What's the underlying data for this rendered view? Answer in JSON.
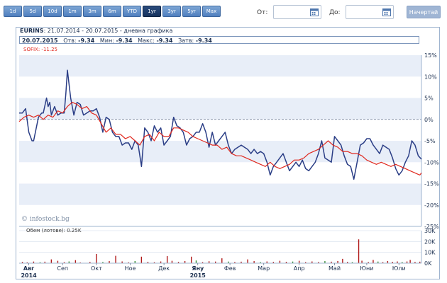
{
  "ranges": [
    "1d",
    "5d",
    "10d",
    "1m",
    "3m",
    "6m",
    "YTD",
    "1yr",
    "3yr",
    "5yr",
    "Max"
  ],
  "range_labels": [
    "1d",
    "5d",
    "10d",
    "1m",
    "3m",
    "6m",
    "YTD",
    "1yr",
    "3yr",
    "5yr",
    "Max"
  ],
  "active_range": "1yr",
  "date_from_label": "От:",
  "date_to_label": "До:",
  "submit_label": "Начертай",
  "chart_title_symbol": "EURINS",
  "chart_title_range": ": 21.07.2014 - 20.07.2015 - дневна графика",
  "info": {
    "date": "20.07.2015",
    "open_label": "Отв:",
    "open": "-9.34",
    "min_label": "Мин:",
    "min": "-9.34",
    "max_label": "Макс:",
    "max": "-9.34",
    "close_label": "Затв:",
    "close": "-9.34"
  },
  "sofix_label": "SOFIX: -11.25",
  "copyright": "© infostock.bg",
  "volume_label": "Обем (лотове): 0.25K",
  "colors": {
    "main_line": "#2b3e86",
    "sofix_line": "#e0291f",
    "band": "#e8eef8",
    "grid": "#c9d5e6"
  },
  "chart_data": {
    "type": "line",
    "x_tick_labels": [
      "Авг",
      "Сеп",
      "Окт",
      "Ное",
      "Дек",
      "Яну",
      "Фев",
      "Мар",
      "Апр",
      "Май",
      "Юни",
      "Юли"
    ],
    "year_labels": [
      "2014",
      "2015"
    ],
    "y_tick_labels": [
      "15%",
      "10%",
      "5%",
      "0%",
      "-5%",
      "-10%",
      "-15%",
      "-20%",
      "-25%"
    ],
    "ylim": [
      -25,
      15
    ],
    "volume_tick_labels": [
      "30K",
      "20K",
      "10K",
      "0K"
    ],
    "volume_ylim": [
      0,
      30
    ],
    "series": [
      {
        "name": "EURINS",
        "x": [
          0,
          2,
          4,
          6,
          8,
          9,
          12,
          14,
          15,
          17,
          18,
          19,
          20,
          22,
          24,
          26,
          28,
          29,
          30,
          32,
          34,
          36,
          38,
          40,
          42,
          44,
          46,
          48,
          50,
          52,
          54,
          56,
          58,
          60,
          62,
          64,
          66,
          68,
          70,
          72,
          74,
          76,
          78,
          80,
          82,
          84,
          86,
          88,
          90,
          92,
          94,
          96,
          98,
          100,
          102,
          104,
          106,
          108,
          110,
          112,
          114,
          116,
          118,
          120,
          122,
          124,
          126,
          128,
          130,
          132,
          134,
          136,
          138,
          140,
          142,
          144,
          146,
          148,
          150,
          152,
          154,
          156,
          158,
          160,
          162,
          164,
          166,
          168,
          170,
          172,
          174,
          176,
          178,
          180,
          182,
          184,
          186,
          188,
          190,
          192,
          194,
          196,
          198,
          200,
          202,
          204,
          206,
          208,
          210,
          212,
          214,
          216,
          218,
          220,
          222,
          224,
          226,
          228,
          230,
          232,
          234,
          236,
          238,
          240,
          242,
          244,
          246,
          248,
          250
        ],
        "values": [
          1.5,
          1.5,
          2.5,
          -3,
          -5,
          -5,
          0.5,
          1.5,
          1.5,
          5,
          3,
          4,
          1,
          3,
          1,
          1.5,
          1.5,
          6,
          11.5,
          5,
          1,
          4,
          3.5,
          1,
          1.5,
          2,
          2,
          2.5,
          0.5,
          -3,
          0.5,
          0,
          -3,
          -4,
          -4,
          -6,
          -5.5,
          -5.5,
          -7,
          -5,
          -6,
          -11,
          -2,
          -3,
          -5,
          -1.5,
          -3,
          -2,
          -6,
          -5,
          -4,
          0.5,
          -1.5,
          -2,
          -3,
          -6,
          -4.5,
          -4,
          -3,
          -3,
          -1,
          -3,
          -6.5,
          -3,
          -6,
          -5,
          -4,
          -3,
          -6,
          -8,
          -7,
          -6.5,
          -6,
          -6.5,
          -7,
          -8,
          -7,
          -8,
          -7.5,
          -8,
          -10,
          -13,
          -11,
          -10,
          -9,
          -8,
          -10,
          -12,
          -11,
          -10,
          -11,
          -9.5,
          -11.5,
          -12,
          -11,
          -10,
          -8,
          -5,
          -9,
          -9.5,
          -10,
          -4,
          -5,
          -6,
          -8.5,
          -10.5,
          -11,
          -14,
          -10,
          -6,
          -5.5,
          -4.5,
          -4.5,
          -6,
          -7,
          -8,
          -6,
          -6.5,
          -7,
          -9,
          -11.5,
          -13,
          -12,
          -10,
          -8.5,
          -5,
          -6,
          -8.5,
          -9.3
        ]
      },
      {
        "name": "SOFIX",
        "x": [
          0,
          3,
          6,
          9,
          12,
          15,
          18,
          21,
          24,
          27,
          30,
          33,
          36,
          39,
          42,
          45,
          48,
          51,
          54,
          57,
          60,
          63,
          66,
          69,
          72,
          75,
          78,
          81,
          84,
          87,
          90,
          93,
          96,
          99,
          102,
          105,
          108,
          111,
          114,
          117,
          120,
          123,
          126,
          129,
          132,
          135,
          138,
          141,
          144,
          147,
          150,
          153,
          156,
          159,
          162,
          165,
          168,
          171,
          174,
          177,
          180,
          183,
          186,
          189,
          192,
          195,
          198,
          201,
          204,
          207,
          210,
          213,
          216,
          219,
          222,
          225,
          228,
          231,
          234,
          237,
          240,
          243,
          246,
          249,
          250
        ],
        "values": [
          -0.5,
          0.5,
          1,
          0.5,
          1,
          0,
          1,
          0.5,
          2,
          1.5,
          3,
          4,
          3.5,
          2.5,
          3,
          1.5,
          1,
          -1,
          -3,
          -2,
          -3.5,
          -3.5,
          -4.5,
          -4,
          -5,
          -6,
          -4,
          -3.5,
          -5,
          -3,
          -4,
          -4,
          -2,
          -2,
          -2.5,
          -3,
          -4,
          -4.5,
          -5,
          -5.5,
          -6,
          -6,
          -7,
          -6.5,
          -8,
          -8.5,
          -8.5,
          -9,
          -9.5,
          -10,
          -10.5,
          -11,
          -10,
          -11,
          -11.5,
          -11,
          -10.5,
          -9.5,
          -9.5,
          -9,
          -8,
          -7.5,
          -7,
          -6,
          -5,
          -6,
          -6.5,
          -7.5,
          -7.5,
          -8,
          -8,
          -8.5,
          -9.5,
          -10,
          -10.5,
          -10,
          -10.5,
          -11,
          -10.5,
          -11,
          -11.5,
          -12,
          -12.5,
          -13,
          -12.5
        ]
      }
    ],
    "volume_bars": [
      {
        "x": 2,
        "value": 1.2
      },
      {
        "x": 5,
        "value": 0.8
      },
      {
        "x": 9,
        "value": 1.5
      },
      {
        "x": 13,
        "value": 0.9
      },
      {
        "x": 16,
        "value": 1.4
      },
      {
        "x": 20,
        "value": 3.5
      },
      {
        "x": 24,
        "value": 2.2
      },
      {
        "x": 28,
        "value": 1.0
      },
      {
        "x": 31,
        "value": 1.6
      },
      {
        "x": 35,
        "value": 2.8
      },
      {
        "x": 38,
        "value": 0.7
      },
      {
        "x": 44,
        "value": 1.2
      },
      {
        "x": 48,
        "value": 8.5
      },
      {
        "x": 52,
        "value": 1.1
      },
      {
        "x": 56,
        "value": 1.9
      },
      {
        "x": 60,
        "value": 6.8
      },
      {
        "x": 64,
        "value": 1.6
      },
      {
        "x": 68,
        "value": 0.8
      },
      {
        "x": 72,
        "value": 2.0
      },
      {
        "x": 76,
        "value": 6.0
      },
      {
        "x": 80,
        "value": 1.3
      },
      {
        "x": 84,
        "value": 0.9
      },
      {
        "x": 88,
        "value": 1.6
      },
      {
        "x": 92,
        "value": 6.5
      },
      {
        "x": 95,
        "value": 2.2
      },
      {
        "x": 99,
        "value": 1.2
      },
      {
        "x": 103,
        "value": 2.0
      },
      {
        "x": 107,
        "value": 6.0
      },
      {
        "x": 110,
        "value": 2.5
      },
      {
        "x": 114,
        "value": 1.0
      },
      {
        "x": 118,
        "value": 1.8
      },
      {
        "x": 122,
        "value": 1.5
      },
      {
        "x": 126,
        "value": 4.5
      },
      {
        "x": 130,
        "value": 1.5
      },
      {
        "x": 134,
        "value": 1.1
      },
      {
        "x": 138,
        "value": 1.4
      },
      {
        "x": 142,
        "value": 3.5
      },
      {
        "x": 146,
        "value": 1.9
      },
      {
        "x": 150,
        "value": 1.0
      },
      {
        "x": 154,
        "value": 1.6
      },
      {
        "x": 158,
        "value": 1.2
      },
      {
        "x": 162,
        "value": 2.2
      },
      {
        "x": 166,
        "value": 1.3
      },
      {
        "x": 170,
        "value": 1.5
      },
      {
        "x": 174,
        "value": 2.2
      },
      {
        "x": 178,
        "value": 1.0
      },
      {
        "x": 182,
        "value": 1.6
      },
      {
        "x": 186,
        "value": 1.1
      },
      {
        "x": 190,
        "value": 1.9
      },
      {
        "x": 194,
        "value": 1.4
      },
      {
        "x": 198,
        "value": 2.0
      },
      {
        "x": 201,
        "value": 4.0
      },
      {
        "x": 204,
        "value": 1.2
      },
      {
        "x": 207,
        "value": 1.0
      },
      {
        "x": 211,
        "value": 22.0
      },
      {
        "x": 213,
        "value": 2.3
      },
      {
        "x": 217,
        "value": 1.1
      },
      {
        "x": 220,
        "value": 3.0
      },
      {
        "x": 223,
        "value": 1.5
      },
      {
        "x": 226,
        "value": 1.0
      },
      {
        "x": 229,
        "value": 2.0
      },
      {
        "x": 232,
        "value": 1.3
      },
      {
        "x": 235,
        "value": 1.6
      },
      {
        "x": 238,
        "value": 1.1
      },
      {
        "x": 241,
        "value": 1.6
      },
      {
        "x": 243,
        "value": 3.0
      },
      {
        "x": 246,
        "value": 1.2
      },
      {
        "x": 249,
        "value": 1.4
      }
    ]
  }
}
